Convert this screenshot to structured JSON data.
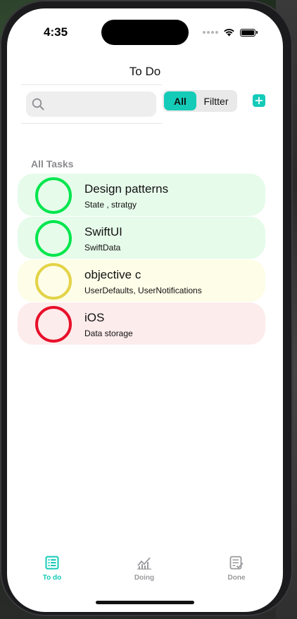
{
  "status_bar": {
    "time": "4:35"
  },
  "nav": {
    "title": "To Do"
  },
  "search": {
    "value": "",
    "placeholder": ""
  },
  "segment": {
    "options": [
      "All",
      "Filtter"
    ],
    "selected": "All"
  },
  "list": {
    "section_header": "All Tasks",
    "tasks": [
      {
        "title": "Design patterns",
        "subtitle": "State , stratgy",
        "ring_color": "#00e64d",
        "bg_color": "#e6fbea"
      },
      {
        "title": "SwiftUI",
        "subtitle": "SwiftData",
        "ring_color": "#00e64d",
        "bg_color": "#e6fbea"
      },
      {
        "title": "objective c",
        "subtitle": "UserDefaults, UserNotifications",
        "ring_color": "#e3d347",
        "bg_color": "#fdfde8"
      },
      {
        "title": "iOS",
        "subtitle": "Data storage",
        "ring_color": "#e8102a",
        "bg_color": "#fdecec"
      }
    ]
  },
  "tabbar": {
    "tabs": [
      {
        "label": "To do",
        "icon": "list-icon",
        "active": true
      },
      {
        "label": "Doing",
        "icon": "chart-icon",
        "active": false
      },
      {
        "label": "Done",
        "icon": "checklist-icon",
        "active": false
      }
    ]
  },
  "colors": {
    "accent": "#14cbb8"
  }
}
